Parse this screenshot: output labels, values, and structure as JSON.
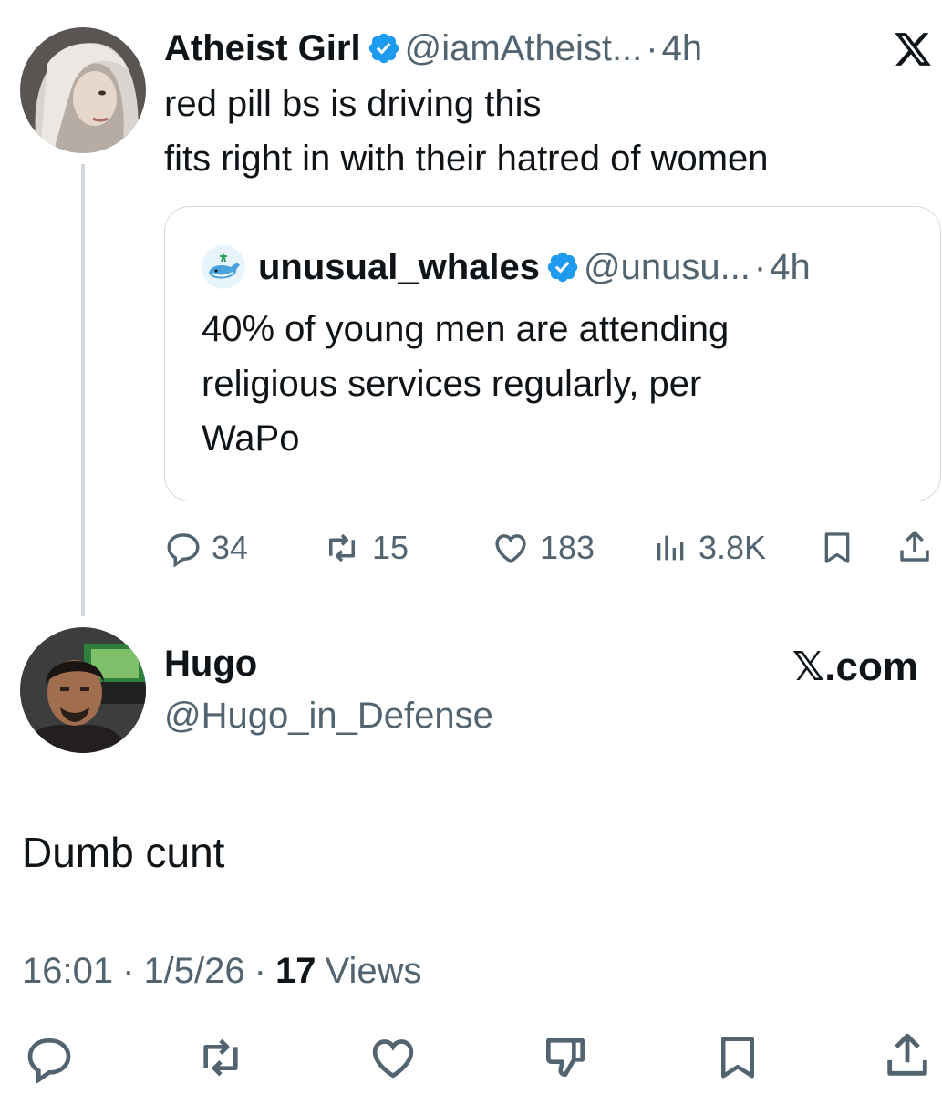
{
  "top_tweet": {
    "display_name": "Atheist Girl",
    "handle": "@iamAtheist...",
    "separator": "·",
    "time": "4h",
    "text_lines": [
      "red pill bs is driving this",
      "fits right in with their hatred of women"
    ],
    "logo_icon": "x-logo-icon",
    "quoted": {
      "display_name": "unusual_whales",
      "handle": "@unusu...",
      "separator": "·",
      "time": "4h",
      "text_lines": [
        "40% of young men are attending",
        "religious services regularly, per",
        "WaPo"
      ]
    },
    "stats": {
      "replies": "34",
      "reposts": "15",
      "likes": "183",
      "views": "3.8K"
    }
  },
  "reply_tweet": {
    "display_name": "Hugo",
    "handle": "@Hugo_in_Defense",
    "brand": "𝕏.com",
    "text": "Dumb cunt",
    "meta": {
      "time": "16:01",
      "sep1": "·",
      "date": "1/5/26",
      "sep2": "·",
      "views_count": "17",
      "views_label": "Views"
    }
  },
  "colors": {
    "verified_blue": "#1d9bf0",
    "text": "#0f1419",
    "muted": "#536471",
    "border": "#cfd9de"
  }
}
